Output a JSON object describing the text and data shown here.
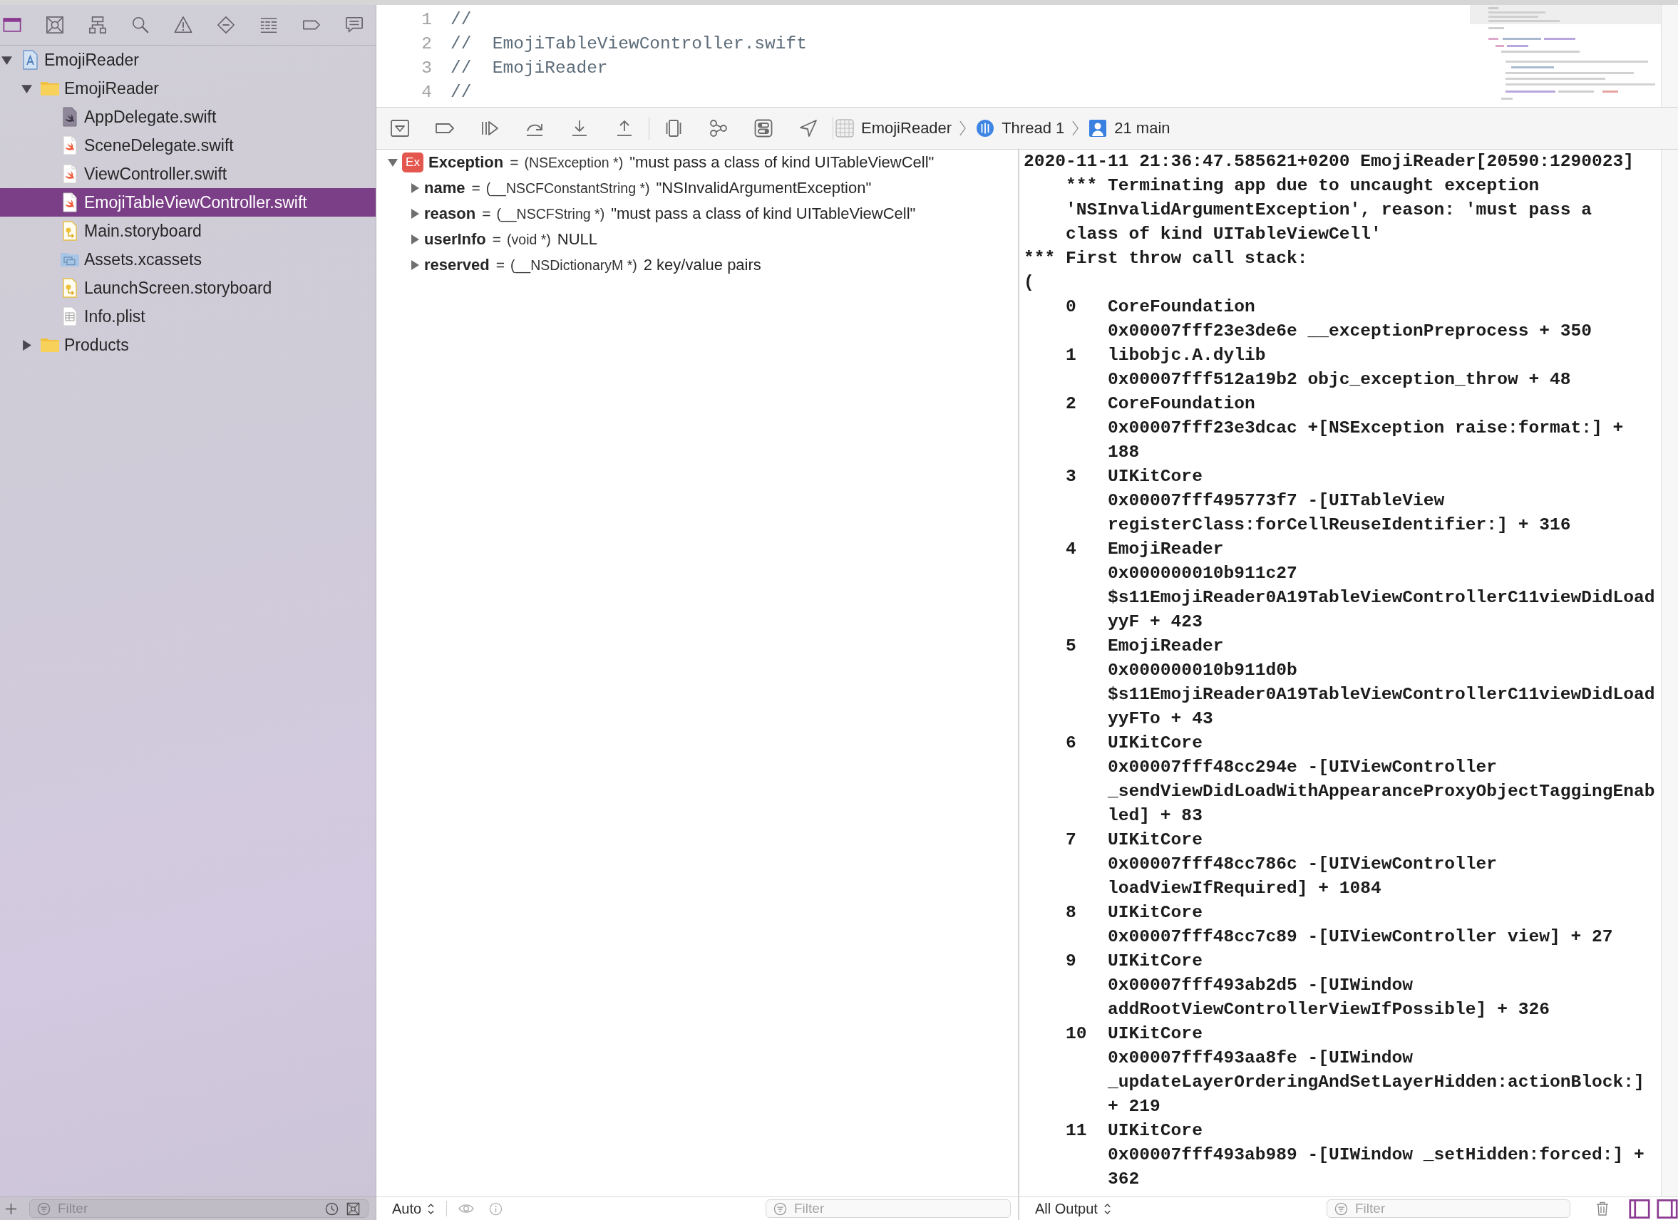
{
  "navigator": {
    "tabs": [
      {
        "kind": "project",
        "selected": true
      },
      {
        "kind": "source_control",
        "selected": false
      },
      {
        "kind": "symbol",
        "selected": false
      },
      {
        "kind": "find",
        "selected": false
      },
      {
        "kind": "issue",
        "selected": false
      },
      {
        "kind": "test",
        "selected": false
      },
      {
        "kind": "debug",
        "selected": false
      },
      {
        "kind": "breakpoint",
        "selected": false
      },
      {
        "kind": "report",
        "selected": false
      }
    ],
    "tree": [
      {
        "label": "EmojiReader",
        "kind": "project",
        "expanded": true,
        "selected": false,
        "children": [
          {
            "label": "EmojiReader",
            "kind": "folder",
            "expanded": true,
            "selected": false,
            "children": [
              {
                "label": "AppDelegate.swift",
                "kind": "swift_plain",
                "selected": false
              },
              {
                "label": "SceneDelegate.swift",
                "kind": "swift",
                "selected": false
              },
              {
                "label": "ViewController.swift",
                "kind": "swift",
                "selected": false
              },
              {
                "label": "EmojiTableViewController.swift",
                "kind": "swift",
                "selected": true
              },
              {
                "label": "Main.storyboard",
                "kind": "storyboard",
                "selected": false
              },
              {
                "label": "Assets.xcassets",
                "kind": "assets",
                "selected": false
              },
              {
                "label": "LaunchScreen.storyboard",
                "kind": "storyboard",
                "selected": false
              },
              {
                "label": "Info.plist",
                "kind": "plist",
                "selected": false
              }
            ]
          },
          {
            "label": "Products",
            "kind": "folder",
            "expanded": false,
            "selected": false
          }
        ]
      }
    ],
    "filter": {
      "placeholder": "Filter"
    }
  },
  "editor": {
    "lines": [
      {
        "number": "1",
        "text": "//"
      },
      {
        "number": "2",
        "text": "//  EmojiTableViewController.swift"
      },
      {
        "number": "3",
        "text": "//  EmojiReader"
      },
      {
        "number": "4",
        "text": "//"
      }
    ]
  },
  "debug_bar": {
    "button_groups": [
      [
        {
          "kind": "toggle_debug_area"
        },
        {
          "kind": "breakpoints"
        },
        {
          "kind": "continue"
        },
        {
          "kind": "step_over"
        },
        {
          "kind": "step_into"
        },
        {
          "kind": "step_out"
        }
      ],
      [
        {
          "kind": "view_debugger"
        },
        {
          "kind": "memory_graph"
        },
        {
          "kind": "environment"
        },
        {
          "kind": "location"
        }
      ]
    ],
    "path": [
      {
        "label": "EmojiReader",
        "kind": "app"
      },
      {
        "label": "Thread 1",
        "kind": "thread"
      },
      {
        "label": "21 main",
        "kind": "frame"
      }
    ]
  },
  "variables": {
    "rows": [
      {
        "name": "Exception",
        "badge": "Ex",
        "op": "=",
        "type": "(NSException *)",
        "value": "\"must pass a class of kind UITableViewCell\"",
        "expanded": true,
        "children": [
          {
            "name": "name",
            "op": "=",
            "type": "(__NSCFConstantString *)",
            "value": "\"NSInvalidArgumentException\"",
            "expanded": false
          },
          {
            "name": "reason",
            "op": "=",
            "type": "(__NSCFString *)",
            "value": "\"must pass a class of kind UITableViewCell\"",
            "expanded": false
          },
          {
            "name": "userInfo",
            "op": "=",
            "type": "(void *)",
            "value": "NULL",
            "expanded": false
          },
          {
            "name": "reserved",
            "op": "=",
            "type": "(__NSDictionaryM *)",
            "value": "2 key/value pairs",
            "expanded": false
          }
        ]
      }
    ],
    "footer": {
      "scope": "Auto",
      "filter_placeholder": "Filter"
    }
  },
  "console": {
    "message": [
      "2020-11-11 21:36:47.585621+0200 EmojiReader[20590:1290023]",
      "*** Terminating app due to uncaught exception",
      "'NSInvalidArgumentException', reason: 'must pass a",
      "class of kind UITableViewCell'"
    ],
    "stack_title": "*** First throw call stack:",
    "open_paren": "(",
    "frames": [
      {
        "index": "0",
        "library": "CoreFoundation",
        "lines": [
          "0x00007fff23e3de6e __exceptionPreprocess + 350"
        ]
      },
      {
        "index": "1",
        "library": "libobjc.A.dylib",
        "lines": [
          "0x00007fff512a19b2 objc_exception_throw + 48"
        ]
      },
      {
        "index": "2",
        "library": "CoreFoundation",
        "lines": [
          "0x00007fff23e3dcac +[NSException raise:format:] +",
          "188"
        ]
      },
      {
        "index": "3",
        "library": "UIKitCore",
        "lines": [
          "0x00007fff495773f7 -[UITableView",
          "registerClass:forCellReuseIdentifier:] + 316"
        ]
      },
      {
        "index": "4",
        "library": "EmojiReader",
        "lines": [
          "0x000000010b911c27",
          "$s11EmojiReader0A19TableViewControllerC11viewDidLoad",
          "yyF + 423"
        ]
      },
      {
        "index": "5",
        "library": "EmojiReader",
        "lines": [
          "0x000000010b911d0b",
          "$s11EmojiReader0A19TableViewControllerC11viewDidLoad",
          "yyFTo + 43"
        ]
      },
      {
        "index": "6",
        "library": "UIKitCore",
        "lines": [
          "0x00007fff48cc294e -[UIViewController",
          "_sendViewDidLoadWithAppearanceProxyObjectTaggingEnab",
          "led] + 83"
        ]
      },
      {
        "index": "7",
        "library": "UIKitCore",
        "lines": [
          "0x00007fff48cc786c -[UIViewController",
          "loadViewIfRequired] + 1084"
        ]
      },
      {
        "index": "8",
        "library": "UIKitCore",
        "lines": [
          "0x00007fff48cc7c89 -[UIViewController view] + 27"
        ]
      },
      {
        "index": "9",
        "library": "UIKitCore",
        "lines": [
          "0x00007fff493ab2d5 -[UIWindow",
          "addRootViewControllerViewIfPossible] + 326"
        ]
      },
      {
        "index": "10",
        "library": "UIKitCore",
        "lines": [
          "0x00007fff493aa8fe -[UIWindow",
          "_updateLayerOrderingAndSetLayerHidden:actionBlock:]",
          "+ 219"
        ]
      },
      {
        "index": "11",
        "library": "UIKitCore",
        "lines": [
          "0x00007fff493ab989 -[UIWindow _setHidden:forced:] +",
          "362"
        ]
      }
    ],
    "footer": {
      "output": "All Output",
      "filter_placeholder": "Filter",
      "view_toggles": [
        {
          "on": true
        },
        {
          "on": true
        }
      ]
    }
  }
}
